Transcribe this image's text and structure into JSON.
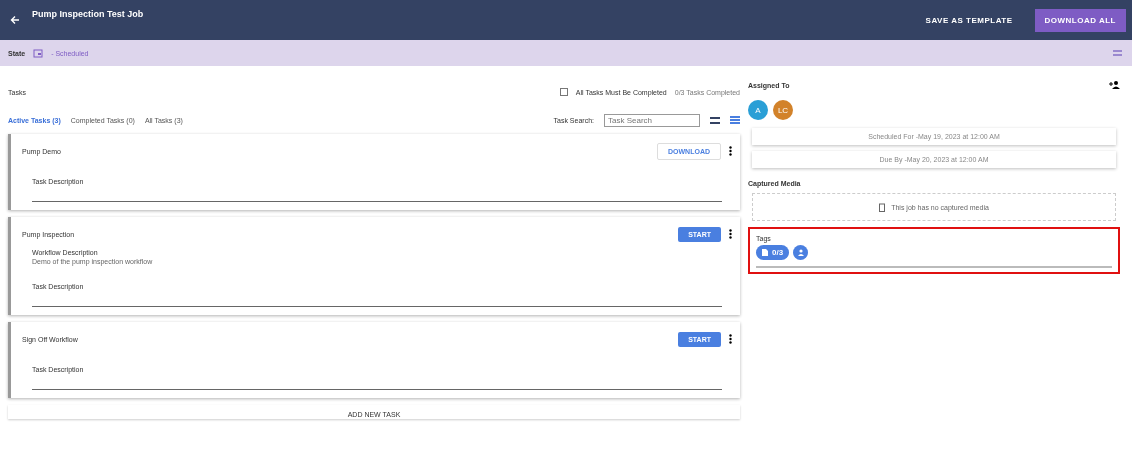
{
  "header": {
    "title": "Pump Inspection Test Job",
    "actions": [
      {
        "label": "SAVE AS TEMPLATE",
        "kind": "text"
      },
      {
        "label": "DOWNLOAD ALL",
        "kind": "filled"
      }
    ]
  },
  "state_bar": {
    "label": "State",
    "value": "- Scheduled"
  },
  "tasks": {
    "title": "Tasks",
    "must_complete": {
      "label": "All Tasks Must Be Completed",
      "checked": false
    },
    "completed_count": "0/3 Tasks Completed",
    "tabs": [
      {
        "label": "Active Tasks (3)",
        "selected": true
      },
      {
        "label": "Completed Tasks (0)",
        "selected": false
      },
      {
        "label": "All Tasks (3)",
        "selected": false
      }
    ],
    "search": {
      "label": "Task Search:",
      "placeholder": "Task Search"
    },
    "items": [
      {
        "name": "Pump Demo",
        "action": {
          "label": "DOWNLOAD",
          "kind": "outlined"
        },
        "task_description_label": "Task Description"
      },
      {
        "name": "Pump Inspection",
        "action": {
          "label": "START",
          "kind": "filled"
        },
        "workflow_description": {
          "label": "Workflow Description",
          "text": "Demo of the pump inspection workflow"
        },
        "task_description_label": "Task Description"
      },
      {
        "name": "Sign Off Workflow",
        "action": {
          "label": "START",
          "kind": "filled"
        },
        "task_description_label": "Task Description"
      }
    ],
    "add_button": "ADD NEW TASK"
  },
  "assigned": {
    "title": "Assigned To",
    "avatars": [
      {
        "initials": "A",
        "color": "#2a9fd6"
      },
      {
        "initials": "LC",
        "color": "#d2822a"
      }
    ]
  },
  "schedule": [
    "Scheduled For -May 19, 2023 at 12:00 AM",
    "Due By -May 20, 2023 at 12:00 AM"
  ],
  "media": {
    "title": "Captured Media",
    "empty": "This job has no captured media"
  },
  "tags": {
    "title": "Tags",
    "chip": "0/3"
  }
}
